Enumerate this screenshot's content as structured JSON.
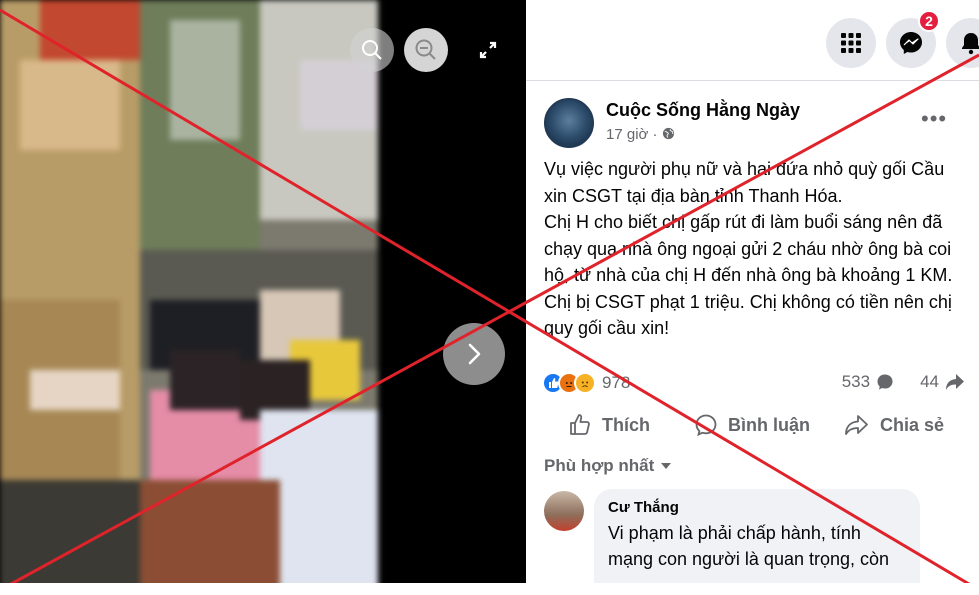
{
  "viewer": {
    "zoom_in_icon": "zoom-in-icon",
    "zoom_out_icon": "zoom-out-icon",
    "fullscreen_icon": "fullscreen-icon",
    "next_icon": "chevron-right-icon"
  },
  "topbar": {
    "menu_icon": "grid-menu-icon",
    "messenger_icon": "messenger-icon",
    "messenger_badge": "2",
    "notifications_icon": "bell-icon"
  },
  "post": {
    "author": "Cuộc Sống Hằng Ngày",
    "time": "17 giờ ·",
    "more_label": "•••",
    "text_lines": [
      "Vụ việc người phụ nữ và hai đứa nhỏ quỳ gối Cầu xin CSGT tại địa bàn tỉnh Thanh Hóa.",
      "Chị H cho biết chị gấp rút đi làm buổi sáng nên đã chạy qua nhà ông ngoại gửi 2 cháu nhờ ông bà coi hộ, từ nhà của chị H đến nhà ông bà khoảng 1 KM. Chị bị CSGT phạt 1 triệu. Chị không có tiền nên chị quy gối cầu xin!"
    ],
    "reaction_count": "978",
    "comment_count": "533",
    "share_count": "44"
  },
  "actions": {
    "like": "Thích",
    "comment": "Bình luận",
    "share": "Chia sẻ"
  },
  "sort": {
    "label": "Phù hợp nhất"
  },
  "comment": {
    "name": "Cư Thắng",
    "text": "Vi phạm là phải chấp hành, tính mạng con người là quan trọng, còn"
  },
  "colors": {
    "x_overlay": "#e0232b",
    "facebook_blue": "#1877f2",
    "badge_red": "#e41e3f"
  }
}
